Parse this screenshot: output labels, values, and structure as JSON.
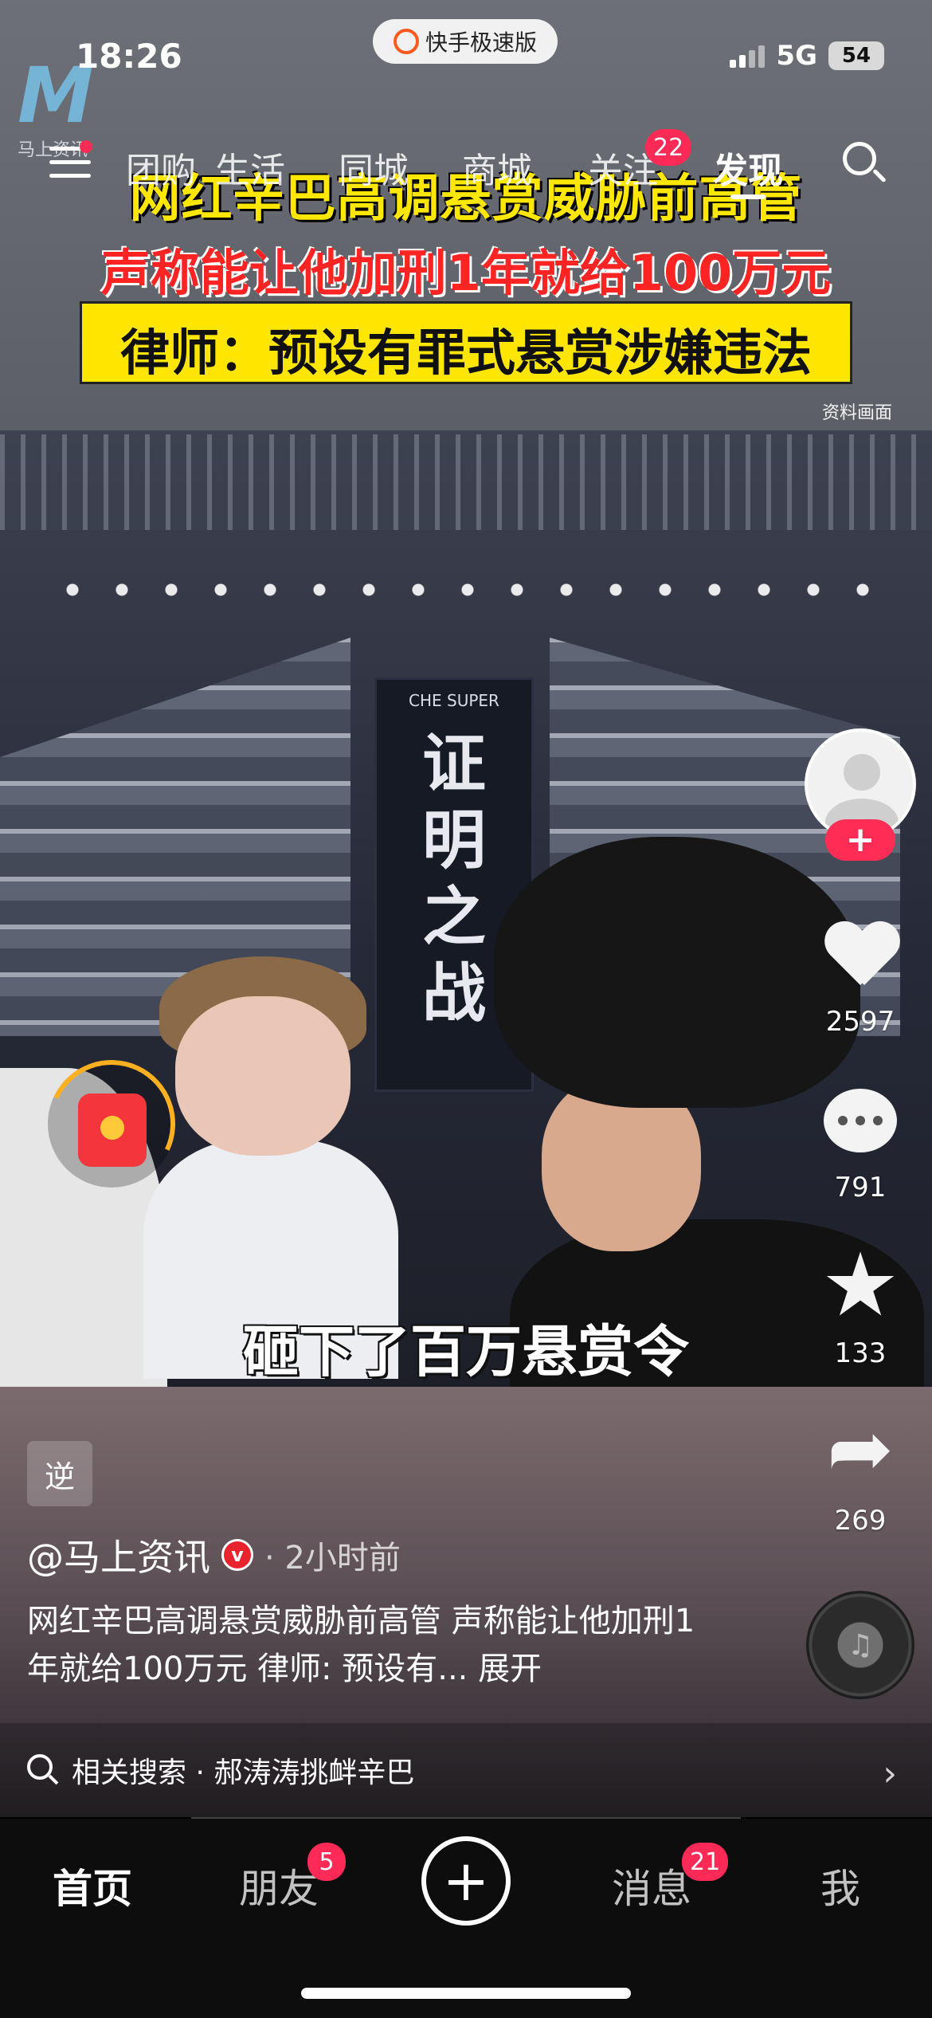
{
  "status_bar": {
    "time": "18:26",
    "network": "5G",
    "battery": "54"
  },
  "app_pill": {
    "label": "快手极速版",
    "icon": "kuaishou-logo-icon"
  },
  "top_nav": {
    "items": [
      {
        "label": "团购"
      },
      {
        "label": "生活"
      },
      {
        "label": "同城"
      },
      {
        "label": "商城"
      },
      {
        "label": "关注",
        "badge": "22"
      },
      {
        "label": "发现",
        "active": true
      }
    ]
  },
  "video": {
    "watermark": "马上资讯",
    "headline_1": "网红辛巴高调悬赏威胁前高管",
    "headline_2": "声称能让他加刑1年就给100万元",
    "headline_3": "律师：预设有罪式悬赏涉嫌违法",
    "source_note": "资料画面",
    "banner_logo": "CHE SUPER",
    "banner_text": "证明之战",
    "subtitle": "砸下了百万悬赏令"
  },
  "right_rail": {
    "follow": "+",
    "likes": "2597",
    "comments": "791",
    "favorites": "133",
    "shares": "269"
  },
  "post": {
    "tag": "逆",
    "author": "@马上资讯",
    "verified_badge": "v",
    "time": "· 2小时前",
    "description": "网红辛巴高调悬赏威胁前高管 声称能让他加刑1年就给100万元 律师: 预设有...",
    "expand": "展开"
  },
  "related_search": {
    "text": "相关搜索 · 郝涛涛挑衅辛巴",
    "chevron": "›"
  },
  "tabbar": {
    "home": "首页",
    "friends": "朋友",
    "friends_badge": "5",
    "plus": "+",
    "messages": "消息",
    "messages_badge": "21",
    "me": "我"
  },
  "colors": {
    "accent": "#ff2d55",
    "headline_yellow": "#ffe700",
    "headline_red": "#ff2424"
  }
}
